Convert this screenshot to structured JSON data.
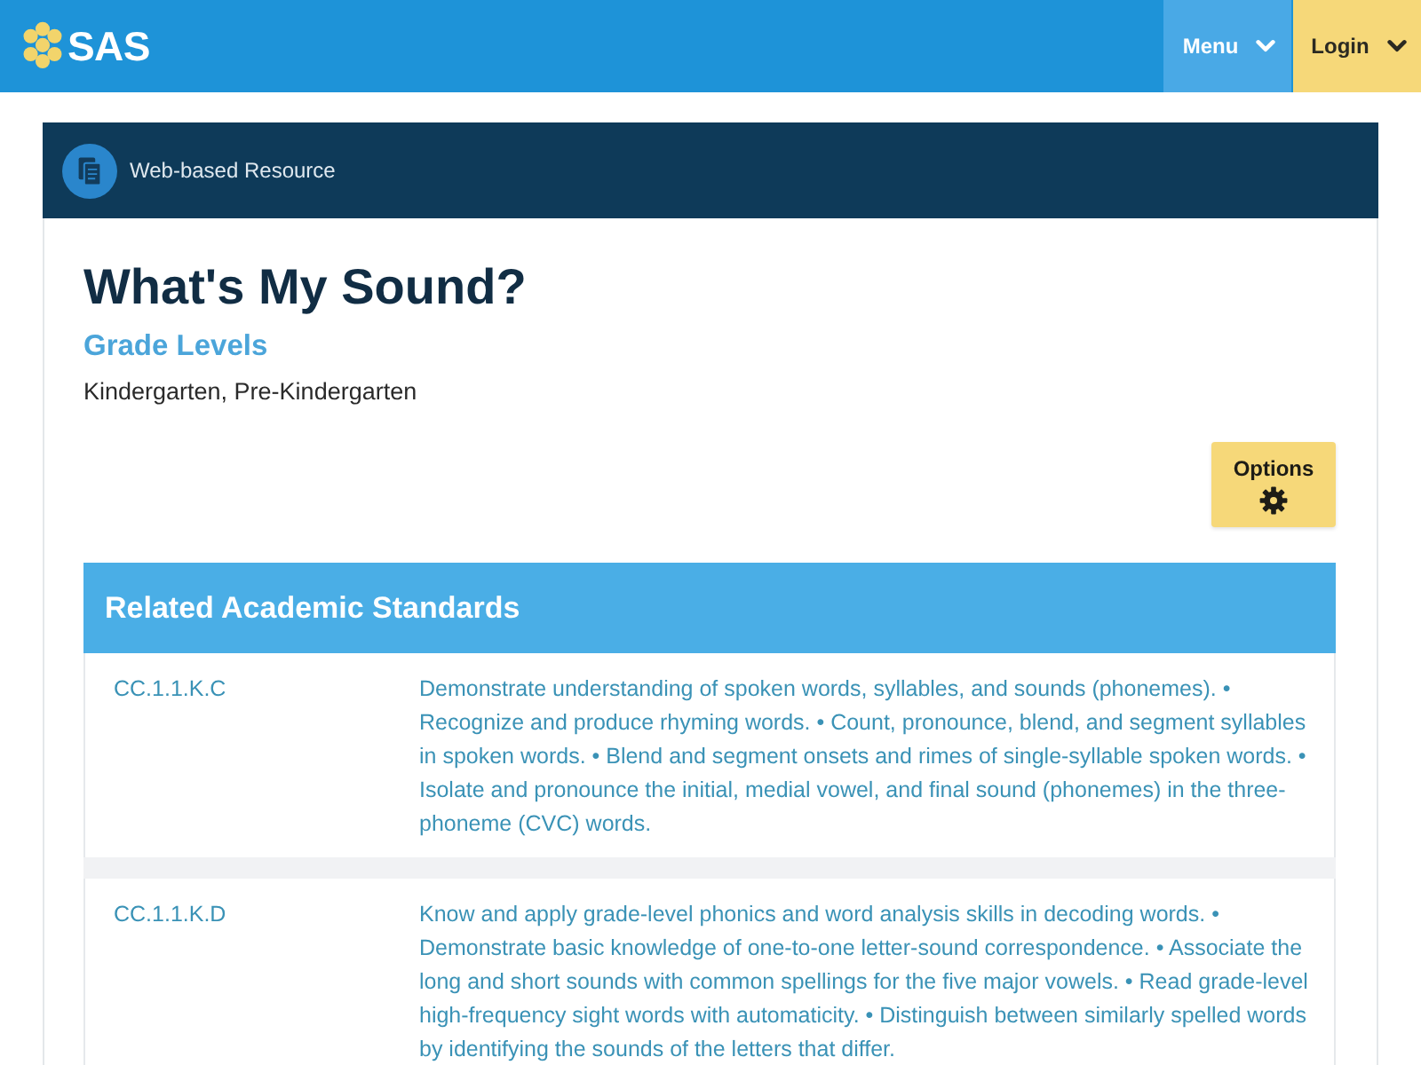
{
  "header": {
    "logo_text": "SAS",
    "menu_button": "Menu",
    "login_button": "Login"
  },
  "resource": {
    "type_label": "Web-based Resource",
    "title": "What's My Sound?",
    "grade_levels_heading": "Grade Levels",
    "grade_levels": "Kindergarten, Pre-Kindergarten",
    "options_button": "Options"
  },
  "standards": {
    "heading": "Related Academic Standards",
    "rows": [
      {
        "code": "CC.1.1.K.C",
        "description": "Demonstrate understanding of spoken words, syllables, and sounds (phonemes). • Recognize and produce rhyming words. • Count, pronounce, blend, and segment syllables in spoken words. • Blend and segment onsets and rimes of single-syllable spoken words. • Isolate and pronounce the initial, medial vowel, and final sound (phonemes) in the three-phoneme (CVC) words."
      },
      {
        "code": "CC.1.1.K.D",
        "description": "Know and apply grade-level phonics and word analysis skills in decoding words. • Demonstrate basic knowledge of one-to-one letter-sound correspondence. • Associate the long and short sounds with common spellings for the five major vowels. • Read grade-level high-frequency sight words with automaticity. • Distinguish between similarly spelled words by identifying the sounds of the letters that differ."
      }
    ]
  }
}
